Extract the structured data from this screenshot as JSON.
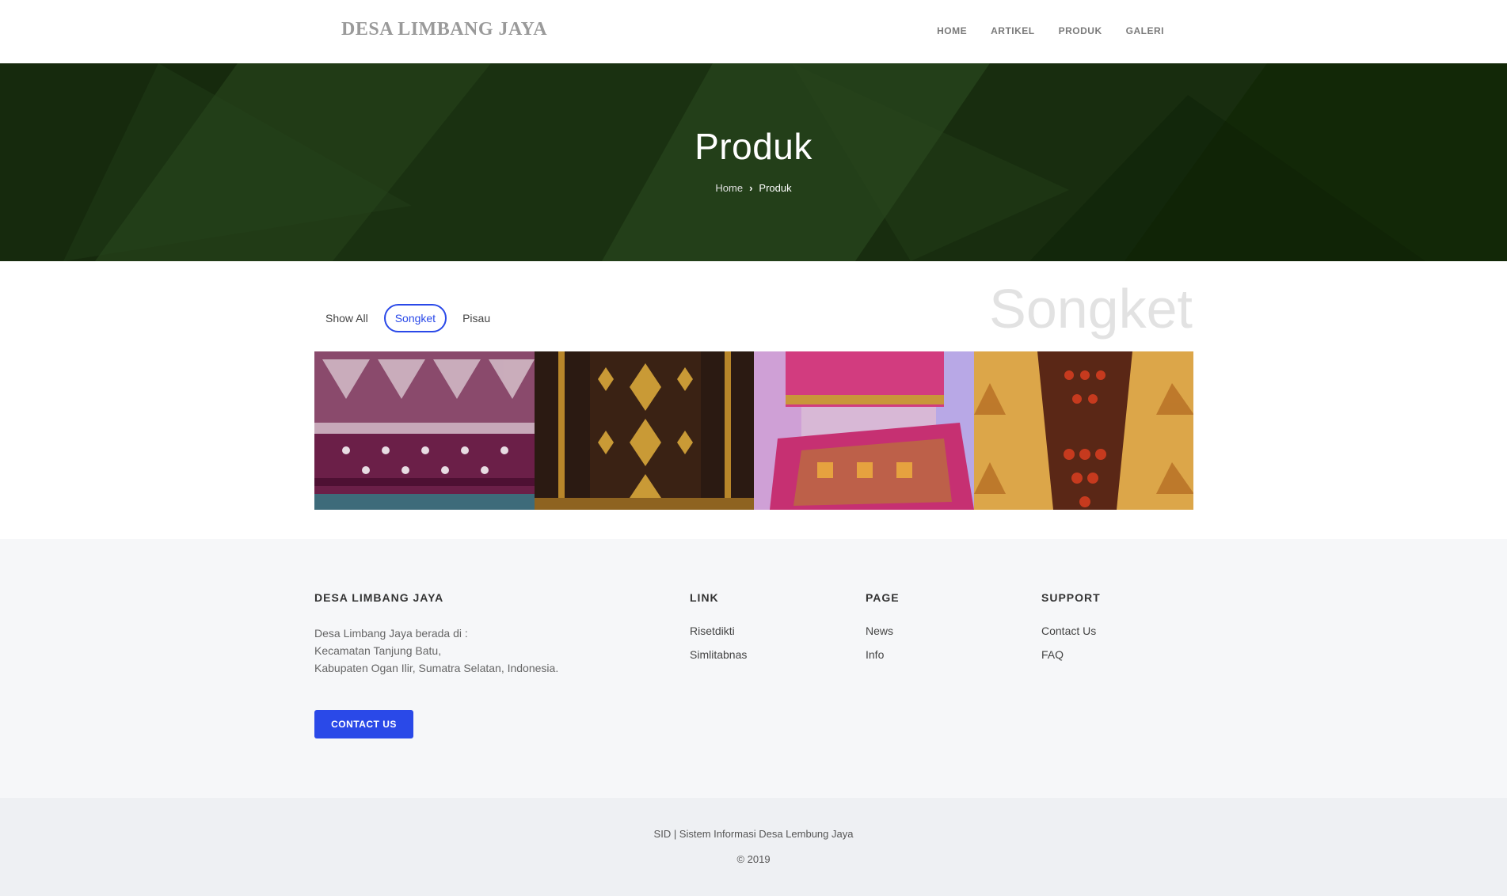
{
  "header": {
    "brand": "DESA LIMBANG JAYA",
    "nav": [
      "HOME",
      "ARTIKEL",
      "PRODUK",
      "GALERI"
    ]
  },
  "hero": {
    "title": "Produk",
    "breadcrumb": {
      "home": "Home",
      "current": "Produk"
    }
  },
  "filters": {
    "items": [
      "Show All",
      "Songket",
      "Pisau"
    ],
    "active": "Songket",
    "active_color": "#2a49e8"
  },
  "section_label": "Songket",
  "footer": {
    "about": {
      "heading": "DESA LIMBANG JAYA",
      "lines": [
        "Desa Limbang Jaya berada di :",
        "Kecamatan Tanjung Batu,",
        "Kabupaten Ogan Ilir, Sumatra Selatan, Indonesia."
      ],
      "button": "CONTACT US"
    },
    "link": {
      "heading": "LINK",
      "items": [
        "Risetdikti",
        "Simlitabnas"
      ]
    },
    "page": {
      "heading": "PAGE",
      "items": [
        "News",
        "Info"
      ]
    },
    "support": {
      "heading": "SUPPORT",
      "items": [
        "Contact Us",
        "FAQ"
      ]
    },
    "copyright_line1": "SID | Sistem Informasi Desa Lembung Jaya",
    "copyright_line2": "© 2019"
  },
  "colors": {
    "accent": "#2a49e8",
    "hero_bg": "#1e3a14"
  }
}
